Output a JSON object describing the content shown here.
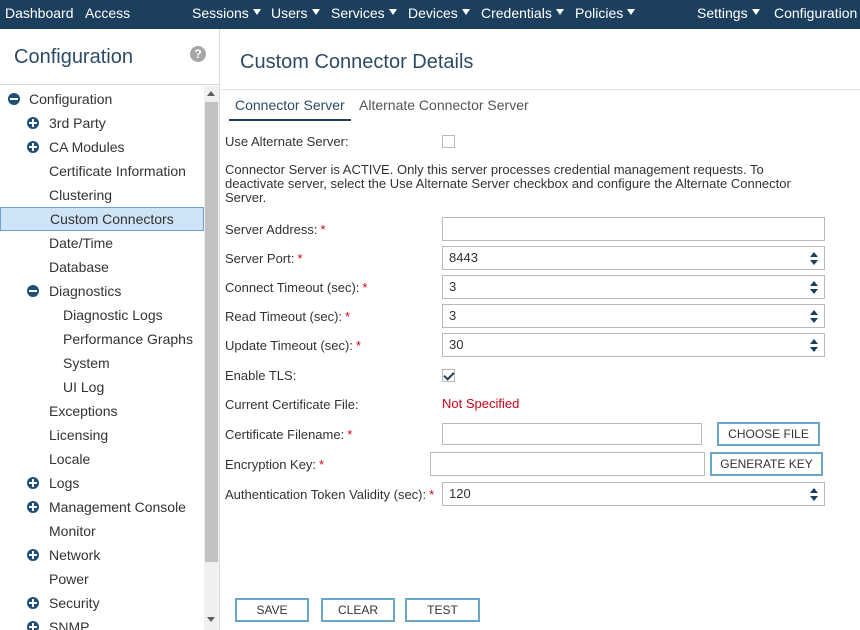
{
  "topnav": {
    "dashboard": "Dashboard",
    "access": "Access",
    "sessions": "Sessions",
    "users": "Users",
    "services": "Services",
    "devices": "Devices",
    "credentials": "Credentials",
    "policies": "Policies",
    "settings": "Settings",
    "configuration": "Configuration"
  },
  "sidebar": {
    "title": "Configuration",
    "help": "?",
    "items": [
      {
        "label": "Configuration",
        "icon": "minus"
      },
      {
        "label": "3rd Party",
        "icon": "plus"
      },
      {
        "label": "CA Modules",
        "icon": "plus"
      },
      {
        "label": "Certificate Information",
        "icon": "none"
      },
      {
        "label": "Clustering",
        "icon": "none"
      },
      {
        "label": "Custom Connectors",
        "icon": "none",
        "selected": true
      },
      {
        "label": "Date/Time",
        "icon": "none"
      },
      {
        "label": "Database",
        "icon": "none"
      },
      {
        "label": "Diagnostics",
        "icon": "minus"
      },
      {
        "label": "Diagnostic Logs",
        "icon": "none"
      },
      {
        "label": "Performance Graphs",
        "icon": "none"
      },
      {
        "label": "System",
        "icon": "none"
      },
      {
        "label": "UI Log",
        "icon": "none"
      },
      {
        "label": "Exceptions",
        "icon": "none"
      },
      {
        "label": "Licensing",
        "icon": "none"
      },
      {
        "label": "Locale",
        "icon": "none"
      },
      {
        "label": "Logs",
        "icon": "plus"
      },
      {
        "label": "Management Console",
        "icon": "plus"
      },
      {
        "label": "Monitor",
        "icon": "none"
      },
      {
        "label": "Network",
        "icon": "plus"
      },
      {
        "label": "Power",
        "icon": "none"
      },
      {
        "label": "Security",
        "icon": "plus"
      },
      {
        "label": "SNMP",
        "icon": "plus"
      }
    ]
  },
  "main": {
    "title": "Custom Connector Details",
    "tabs": [
      {
        "label": "Connector Server",
        "active": true
      },
      {
        "label": "Alternate Connector Server",
        "active": false
      }
    ],
    "use_alternate_label": "Use Alternate Server:",
    "use_alternate_checked": false,
    "status_text": "Connector Server is ACTIVE. Only this server processes credential management requests. To deactivate server, select the Use Alternate Server checkbox and configure the Alternate Connector Server.",
    "fields": {
      "server_address": {
        "label": "Server Address:",
        "value": ""
      },
      "server_port": {
        "label": "Server Port:",
        "value": "8443"
      },
      "connect_timeout": {
        "label": "Connect Timeout (sec):",
        "value": "3"
      },
      "read_timeout": {
        "label": "Read Timeout (sec):",
        "value": "3"
      },
      "update_timeout": {
        "label": "Update Timeout (sec):",
        "value": "30"
      },
      "enable_tls": {
        "label": "Enable TLS:",
        "checked": true
      },
      "current_cert": {
        "label": "Current Certificate File:",
        "value": "Not Specified"
      },
      "cert_filename": {
        "label": "Certificate Filename:",
        "value": ""
      },
      "encryption_key": {
        "label": "Encryption Key:",
        "value": ""
      },
      "auth_token_validity": {
        "label": "Authentication Token Validity (sec):",
        "value": "120"
      }
    },
    "required_mark": "*",
    "buttons": {
      "choose_file": "CHOOSE FILE",
      "generate_key": "GENERATE KEY",
      "save": "SAVE",
      "clear": "CLEAR",
      "test": "TEST"
    }
  },
  "colors": {
    "nav_bg": "#1d3f5e",
    "title": "#2d4b66",
    "required": "#d0021b",
    "selected_bg": "#cfe3f6",
    "button_border": "#6aa6c8"
  }
}
